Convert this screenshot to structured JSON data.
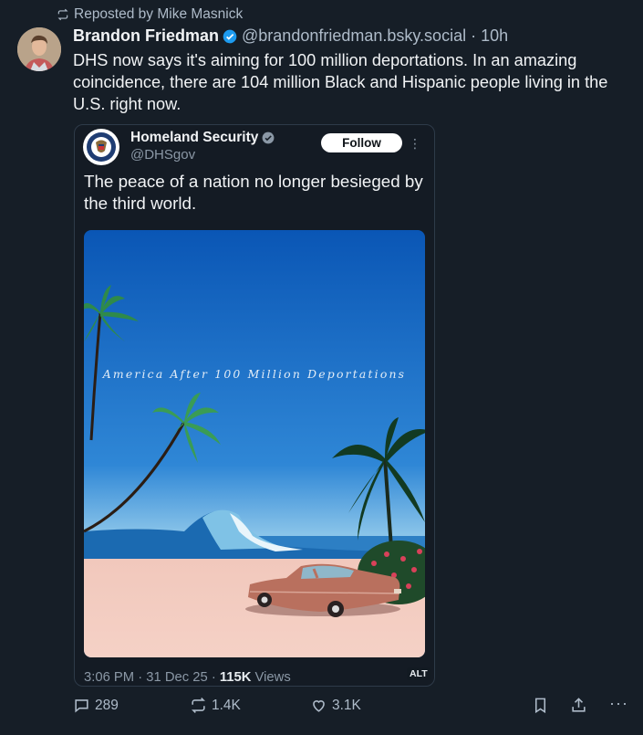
{
  "repost": {
    "label": "Reposted by Mike Masnick"
  },
  "post": {
    "author_name": "Brandon Friedman",
    "handle": "@brandonfriedman.bsky.social",
    "separator": "·",
    "time": "10h",
    "text": "DHS now says it's aiming for 100 million deportations. In an amazing coincidence, there are 104 million Black and Hispanic people living in the U.S. right now."
  },
  "quote": {
    "author_name": "Homeland Security",
    "handle": "@DHSgov",
    "follow_label": "Follow",
    "more_icon": "⋮",
    "text": "The peace of a nation no longer besieged by the third world.",
    "image_title": "America After 100 Million Deportations",
    "meta_time": "3:06 PM · 31 Dec 25 · ",
    "meta_views_count": "115K",
    "meta_views_label": " Views",
    "alt_label": "ALT"
  },
  "actions": {
    "reply_count": "289",
    "repost_count": "1.4K",
    "like_count": "3.1K",
    "more_label": "···"
  },
  "colors": {
    "background": "#161e27",
    "verified": "#1d9bf0",
    "muted_text": "#aebbc9"
  }
}
